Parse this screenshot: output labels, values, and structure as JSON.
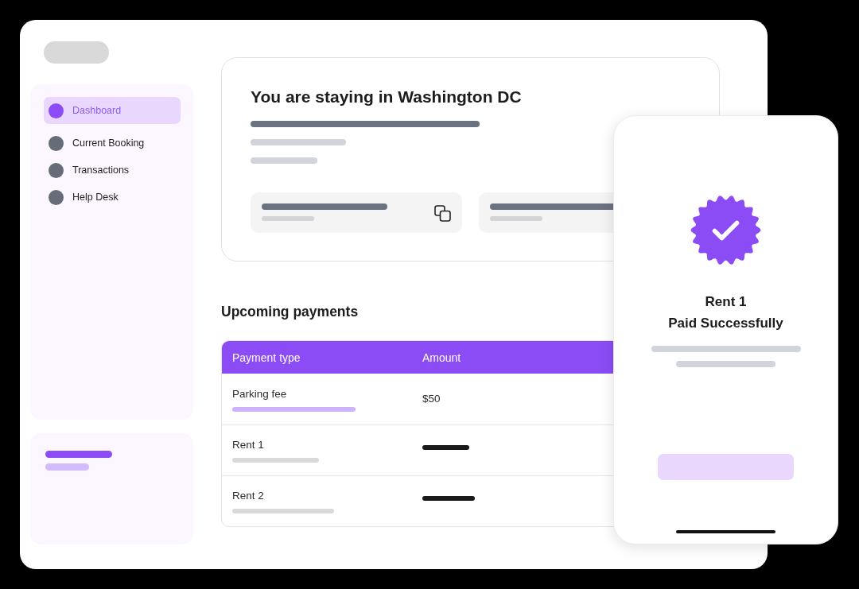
{
  "sidebar": {
    "items": [
      {
        "label": "Dashboard",
        "selected": true
      },
      {
        "label": "Current Booking",
        "selected": false
      },
      {
        "label": "Transactions",
        "selected": false
      },
      {
        "label": "Help Desk",
        "selected": false
      }
    ]
  },
  "stay_card": {
    "title": "You are staying in Washington DC"
  },
  "payments": {
    "title": "Upcoming payments",
    "columns": [
      "Payment type",
      "Amount"
    ],
    "rows": [
      {
        "type": "Parking fee",
        "amount": "$50",
        "selected": true
      },
      {
        "type": "Rent 1",
        "selected": false
      },
      {
        "type": "Rent 2",
        "selected": false
      }
    ]
  },
  "phone": {
    "title": "Rent 1",
    "subtitle": "Paid Successfully"
  }
}
